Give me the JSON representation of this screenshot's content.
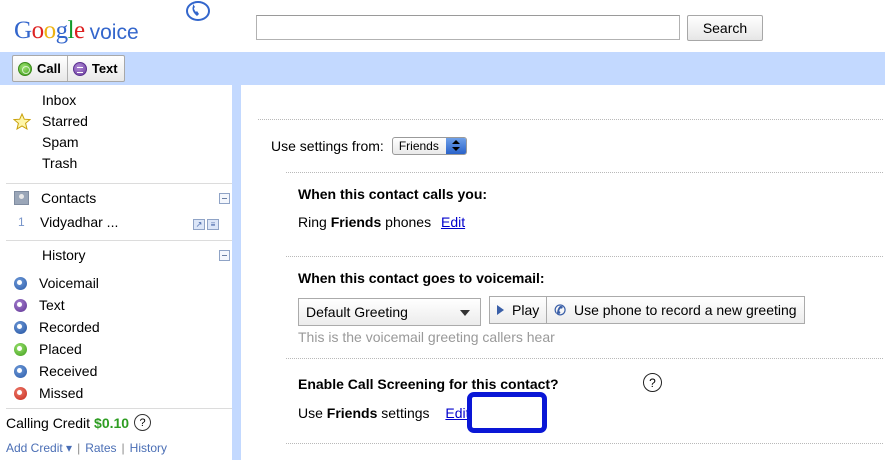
{
  "header": {
    "logo_google": "Google",
    "logo_voice": "voice",
    "search_placeholder": "",
    "search_button": "Search"
  },
  "actions": {
    "call_label": "Call",
    "text_label": "Text"
  },
  "sidebar": {
    "nav_items": [
      "Inbox",
      "Starred",
      "Spam",
      "Trash"
    ],
    "contacts_label": "Contacts",
    "contact_count": "1",
    "contact_name": "Vidyadhar ...",
    "history_label": "History",
    "history_items": [
      "Voicemail",
      "Text",
      "Recorded",
      "Placed",
      "Received",
      "Missed"
    ],
    "credit_label": "Calling Credit",
    "credit_amount": "$0.10",
    "help_glyph": "?",
    "add_credit": "Add Credit ▾",
    "rates": "Rates",
    "history_link": "History",
    "sep": "|"
  },
  "main": {
    "use_settings_label": "Use settings from:",
    "use_settings_value": "Friends",
    "calls_title": "When this contact calls you:",
    "calls_text_pre": "Ring ",
    "calls_text_bold": "Friends",
    "calls_text_post": " phones",
    "calls_edit": "Edit",
    "voicemail_title": "When this contact goes to voicemail:",
    "greeting_value": "Default Greeting",
    "play_label": "Play",
    "record_label": "Use phone to record a new greeting",
    "greeting_hint": "This is the voicemail greeting callers hear",
    "screening_title": "Enable Call Screening for this contact?",
    "screening_help": "?",
    "screening_text_pre": "Use ",
    "screening_text_bold": "Friends",
    "screening_text_post": " settings",
    "screening_edit": "Edit"
  },
  "colors": {
    "accent_bar": "#c3d9ff",
    "link": "#0000cc",
    "credit": "#2e9d22",
    "highlight": "#0a17d6"
  }
}
